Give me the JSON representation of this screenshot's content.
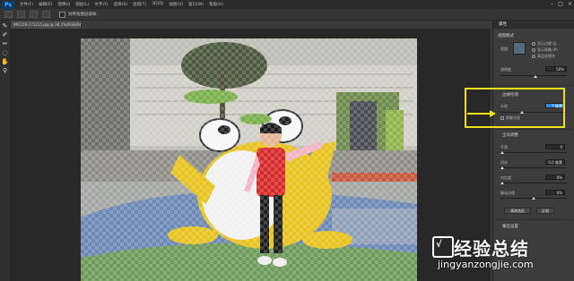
{
  "menu": {
    "logo": "Ps",
    "items": [
      "文件(F)",
      "编辑(E)",
      "图像(I)",
      "图层(L)",
      "文字(Y)",
      "选择(S)",
      "滤镜(T)",
      "3D(D)",
      "视图(V)",
      "窗口(W)",
      "帮助(H)"
    ]
  },
  "options": {
    "checkbox_label": "对所有图层取样"
  },
  "document": {
    "tab_title": "IMG116-172215.jpg @ 28.2%(RGB/8#) *"
  },
  "panel": {
    "tab": "属性",
    "view_mode_label": "视图模式",
    "view_label": "视图:",
    "show_edge": "显示边缘 (J)",
    "show_original": "显示原稿 (P)",
    "high_quality": "高品质预览",
    "transparency_label": "透明度",
    "transparency_value": "50%",
    "edge_detection_label": "边缘检测",
    "radius_label": "半径",
    "radius_value": "7 像素",
    "smart_radius": "智能半径",
    "global_refine_label": "全局调整",
    "smooth_label": "平滑",
    "smooth_value": "0",
    "feather_label": "羽化",
    "feather_value": "0.0 像素",
    "contrast_label": "对比度",
    "contrast_value": "0%",
    "shift_edge_label": "移动边缘",
    "shift_edge_value": "0%",
    "clear_selection": "清除选区",
    "invert": "反相",
    "output_settings": "输出设置"
  },
  "watermark": {
    "cn": "经验总结",
    "url": "jingyanzongjie.com",
    "badge": "√"
  },
  "colors": {
    "highlight": "#f2e01a",
    "ps_blue": "#2d8ceb"
  }
}
